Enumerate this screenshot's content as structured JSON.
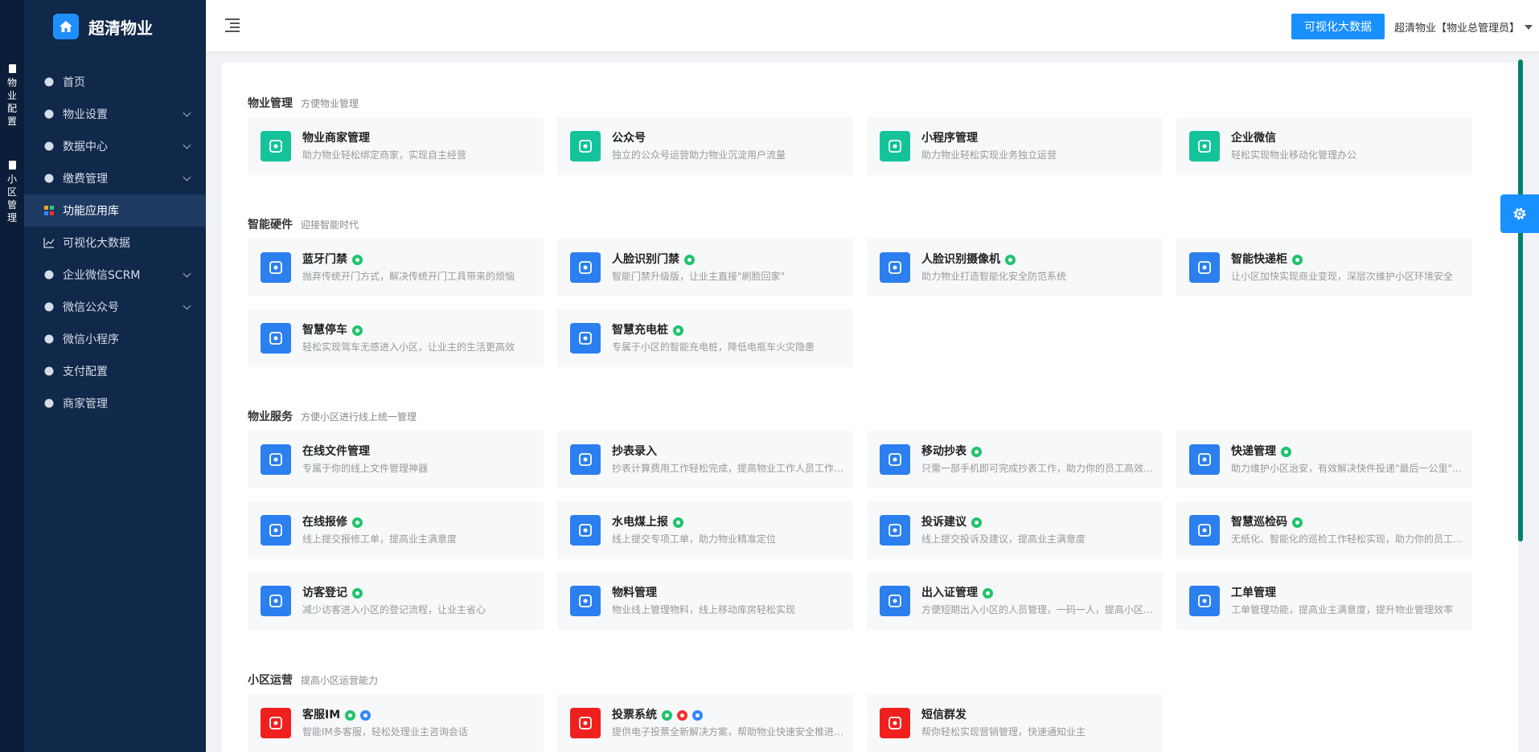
{
  "rail": {
    "groups": [
      {
        "label": "物业配置"
      },
      {
        "label": "小区管理"
      }
    ]
  },
  "sidebar": {
    "logo_title": "超清物业",
    "items": [
      {
        "label": "首页",
        "icon": "home-icon",
        "has_children": false,
        "active": false
      },
      {
        "label": "物业设置",
        "icon": "monitor-icon",
        "has_children": true,
        "active": false
      },
      {
        "label": "数据中心",
        "icon": "database-icon",
        "has_children": true,
        "active": false
      },
      {
        "label": "缴费管理",
        "icon": "money-bag-icon",
        "has_children": true,
        "active": false
      },
      {
        "label": "功能应用库",
        "icon": "app-grid-icon",
        "has_children": false,
        "active": true
      },
      {
        "label": "可视化大数据",
        "icon": "line-chart-icon",
        "has_children": false,
        "active": false
      },
      {
        "label": "企业微信SCRM",
        "icon": "chat-bubble-icon",
        "has_children": true,
        "active": false
      },
      {
        "label": "微信公众号",
        "icon": "wechat-icon",
        "has_children": true,
        "active": false
      },
      {
        "label": "微信小程序",
        "icon": "mini-program-icon",
        "has_children": false,
        "active": false
      },
      {
        "label": "支付配置",
        "icon": "wallet-icon",
        "has_children": false,
        "active": false
      },
      {
        "label": "商家管理",
        "icon": "store-icon",
        "has_children": false,
        "active": false
      }
    ]
  },
  "topbar": {
    "bigdata_button": "可视化大数据",
    "user_label": "超清物业【物业总管理员】"
  },
  "sections": [
    {
      "name": "物业管理",
      "desc": "方便物业管理",
      "cards": [
        {
          "title": "物业商家管理",
          "desc": "助力物业轻松绑定商家，实现自主经营",
          "icon": "store-icon",
          "color": "#14c39a",
          "badges": []
        },
        {
          "title": "公众号",
          "desc": "独立的公众号运营助力物业沉淀用户流量",
          "icon": "wechat-icon",
          "color": "#14c39a",
          "badges": []
        },
        {
          "title": "小程序管理",
          "desc": "助力物业轻松实现业务独立运营",
          "icon": "mini-program-icon",
          "color": "#14c39a",
          "badges": []
        },
        {
          "title": "企业微信",
          "desc": "轻松实现物业移动化管理办公",
          "icon": "chat-bubble-icon",
          "color": "#14c39a",
          "badges": []
        }
      ]
    },
    {
      "name": "智能硬件",
      "desc": "迎接智能时代",
      "cards": [
        {
          "title": "蓝牙门禁",
          "desc": "抛弃传统开门方式，解决传统开门工具带来的烦恼",
          "icon": "bluetooth-icon",
          "color": "#2b7fee",
          "badges": [
            "green"
          ]
        },
        {
          "title": "人脸识别门禁",
          "desc": "智能门禁升级版，让业主直接\"刷脸回家\"",
          "icon": "face-scan-icon",
          "color": "#2b7fee",
          "badges": [
            "green"
          ]
        },
        {
          "title": "人脸识别摄像机",
          "desc": "助力物业打造智能化安全防范系统",
          "icon": "camera-icon",
          "color": "#2b7fee",
          "badges": [
            "green"
          ]
        },
        {
          "title": "智能快递柜",
          "desc": "让小区加快实现商业变现，深层次维护小区环境安全",
          "icon": "locker-icon",
          "color": "#2b7fee",
          "badges": [
            "green"
          ]
        },
        {
          "title": "智慧停车",
          "desc": "轻松实现驾车无感进入小区，让业主的生活更高效",
          "icon": "parking-icon",
          "color": "#2b7fee",
          "badges": [
            "green"
          ]
        },
        {
          "title": "智慧充电桩",
          "desc": "专属于小区的智能充电桩，降低电瓶车火灾隐患",
          "icon": "charger-icon",
          "color": "#2b7fee",
          "badges": [
            "green"
          ]
        }
      ]
    },
    {
      "name": "物业服务",
      "desc": "方便小区进行线上统一管理",
      "cards": [
        {
          "title": "在线文件管理",
          "desc": "专属于你的线上文件管理神器",
          "icon": "edit-document-icon",
          "color": "#2b7fee",
          "badges": []
        },
        {
          "title": "抄表录入",
          "desc": "抄表计算费用工作轻松完成，提高物业工作人员工作效率",
          "icon": "meter-entry-icon",
          "color": "#2b7fee",
          "badges": []
        },
        {
          "title": "移动抄表",
          "desc": "只需一部手机即可完成抄表工作，助力你的员工高效工作",
          "icon": "mobile-meter-icon",
          "color": "#2b7fee",
          "badges": [
            "green"
          ]
        },
        {
          "title": "快递管理",
          "desc": "助力维护小区治安，有效解决快件投递\"最后一公里\"难题",
          "icon": "package-icon",
          "color": "#2b7fee",
          "badges": [
            "green"
          ]
        },
        {
          "title": "在线报修",
          "desc": "线上提交报修工单，提高业主满意度",
          "icon": "tools-icon",
          "color": "#2b7fee",
          "badges": [
            "green"
          ]
        },
        {
          "title": "水电煤上报",
          "desc": "线上提交专项工单，助力物业精准定位",
          "icon": "utility-icon",
          "color": "#2b7fee",
          "badges": [
            "green"
          ]
        },
        {
          "title": "投诉建议",
          "desc": "线上提交投诉及建议，提高业主满意度",
          "icon": "complaint-icon",
          "color": "#2b7fee",
          "badges": [
            "green"
          ]
        },
        {
          "title": "智慧巡检码",
          "desc": "无纸化、智能化的巡检工作轻松实现，助力你的员工高效巡检",
          "icon": "qr-grid-icon",
          "color": "#2b7fee",
          "badges": [
            "green"
          ]
        },
        {
          "title": "访客登记",
          "desc": "减少访客进入小区的登记流程，让业主省心",
          "icon": "visitor-icon",
          "color": "#2b7fee",
          "badges": [
            "green"
          ]
        },
        {
          "title": "物料管理",
          "desc": "物业线上管理物料，线上移动库房轻松实现",
          "icon": "cube-icon",
          "color": "#2b7fee",
          "badges": []
        },
        {
          "title": "出入证管理",
          "desc": "方便短期出入小区的人员管理，一码一人，提高小区安全",
          "icon": "pass-card-icon",
          "color": "#2b7fee",
          "badges": [
            "green"
          ]
        },
        {
          "title": "工单管理",
          "desc": "工单管理功能，提高业主满意度，提升物业管理效率",
          "icon": "work-order-icon",
          "color": "#2b7fee",
          "badges": []
        }
      ]
    },
    {
      "name": "小区运营",
      "desc": "提高小区运营能力",
      "cards": [
        {
          "title": "客服IM",
          "desc": "智能IM多客服，轻松处理业主咨询会话",
          "icon": "headset-icon",
          "color": "#f0201f",
          "badges": [
            "green",
            "blue"
          ]
        },
        {
          "title": "投票系统",
          "desc": "提供电子投票全新解决方案，帮助物业快速安全推进小区决策",
          "icon": "vote-icon",
          "color": "#f0201f",
          "badges": [
            "green",
            "red",
            "blue"
          ]
        },
        {
          "title": "短信群发",
          "desc": "帮你轻松实现营销管理，快速通知业主",
          "icon": "mail-icon",
          "color": "#f0201f",
          "badges": []
        }
      ]
    }
  ]
}
